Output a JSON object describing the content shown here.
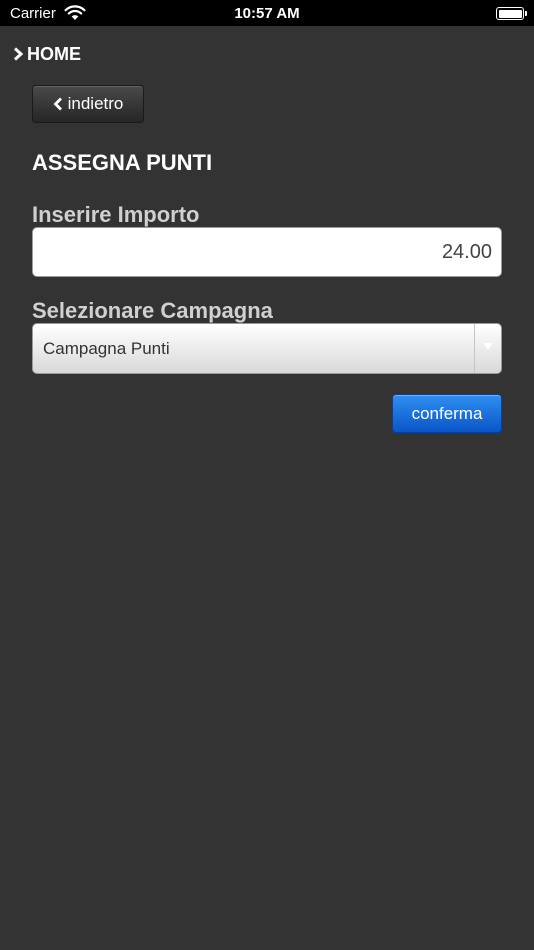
{
  "status_bar": {
    "carrier": "Carrier",
    "time": "10:57 AM"
  },
  "nav": {
    "home_label": "HOME",
    "back_label": "indietro"
  },
  "form": {
    "title": "ASSEGNA PUNTI",
    "amount_label": "Inserire Importo",
    "amount_value": "24.00",
    "campaign_label": "Selezionare Campagna",
    "campaign_selected": "Campagna Punti",
    "confirm_label": "conferma"
  },
  "colors": {
    "background": "#333333",
    "confirm_button": "#1a6fe0",
    "label_text": "#d0d0d0"
  },
  "icons": {
    "home": "chevron-right-icon",
    "back": "chevron-left-icon",
    "select": "triangle-down-icon"
  }
}
